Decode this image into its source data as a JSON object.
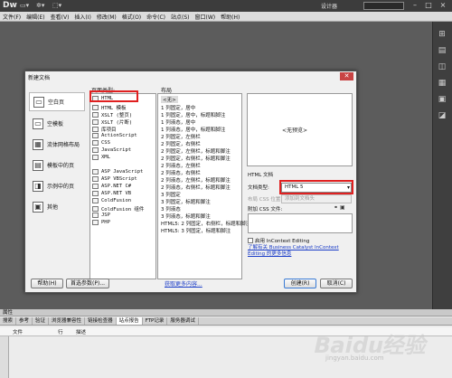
{
  "app": {
    "logo": "Dw",
    "designer": "设计器",
    "window_controls": [
      "–",
      "□",
      "×"
    ]
  },
  "menu": [
    "文件(F)",
    "编辑(E)",
    "查看(V)",
    "插入(I)",
    "修改(M)",
    "格式(O)",
    "命令(C)",
    "站点(S)",
    "窗口(W)",
    "帮助(H)"
  ],
  "dialog": {
    "title": "新建文档",
    "categories": [
      "空白页",
      "空模板",
      "流体网格布局",
      "模板中的页",
      "示例中的页",
      "其他"
    ],
    "type_header": "页面类型:",
    "types": [
      "HTML",
      "HTML 模板",
      "XSLT (整页)",
      "XSLT (片断)",
      "库项目",
      "ActionScript",
      "CSS",
      "JavaScript",
      "XML",
      "",
      "ASP JavaScript",
      "ASP VBScript",
      "ASP.NET C#",
      "ASP.NET VB",
      "ColdFusion",
      "ColdFusion 组件",
      "JSP",
      "PHP"
    ],
    "layout_header": "布局",
    "layouts": [
      "<无>",
      "1 列固定，居中",
      "1 列固定，居中，标题和脚注",
      "1 列液态，居中",
      "1 列液态，居中，标题和脚注",
      "2 列固定，左侧栏",
      "2 列固定，右侧栏",
      "2 列固定，左侧栏，标题和脚注",
      "2 列固定，右侧栏，标题和脚注",
      "2 列液态，左侧栏",
      "2 列液态，右侧栏",
      "2 列液态，左侧栏，标题和脚注",
      "2 列液态，右侧栏，标题和脚注",
      "3 列固定",
      "3 列固定，标题和脚注",
      "3 列液态",
      "3 列液态，标题和脚注",
      "HTML5: 2 列固定，右侧栏，标题和脚注",
      "HTML5: 3 列固定，标题和脚注"
    ],
    "no_preview": "<无预览>",
    "html_doc": "HTML 文档",
    "doctype_label": "文档类型:",
    "doctype_value": "HTML 5",
    "layout_css_label": "布局 CSS 位置:",
    "layout_css_value": "添加到文档头",
    "attach_css_label": "附加 CSS 文件:",
    "incontext_label": "启用 InContext Editing",
    "learn_link": "了解有关 Business Catalyst InContext Editing 的更多信息",
    "help_button": "帮助(H)",
    "prefs_button": "首选参数(P)...",
    "more_content_link": "获取更多内容...",
    "create_button": "创建(R)",
    "cancel_button": "取消(C)"
  },
  "bottom": {
    "properties": "属性",
    "tabs": [
      "搜索",
      "参考",
      "验证",
      "浏览器兼容性",
      "链接检查器",
      "站点报告",
      "FTP记录",
      "服务器调试"
    ],
    "columns": [
      "文件",
      "行",
      "描述"
    ]
  },
  "watermark": {
    "logo": "Baidu经验",
    "url": "jingyan.baidu.com"
  }
}
